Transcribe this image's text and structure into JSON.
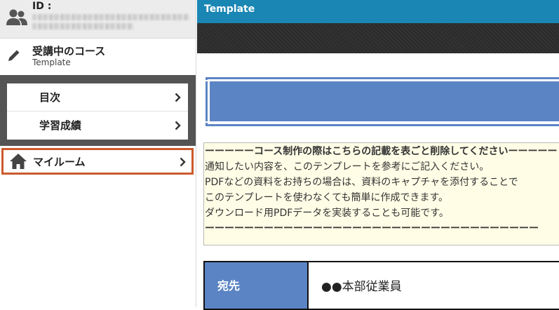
{
  "sidebar": {
    "user": {
      "id_label": "ID :"
    },
    "course": {
      "heading": "受講中のコース",
      "name": "Template"
    },
    "menu": [
      {
        "label": "目次"
      },
      {
        "label": "学習成績"
      }
    ],
    "myroom": {
      "label": "マイルーム"
    }
  },
  "main": {
    "topbar_title": "Template",
    "notice": {
      "line1": "ーーーーーコース制作の際はこちらの記載を表ごと削除してくださいーーーーー",
      "line2": "通知したい内容を、このテンプレートを参考にご記入ください。",
      "line3": "PDFなどの資料をお持ちの場合は、資料のキャプチャを添付することで",
      "line4": "このテンプレートを使わなくても簡単に作成できます。",
      "line5": "ダウンロード用PDFデータを実装することも可能です。",
      "line6": "ーーーーーーーーーーーーーーーーーーーーーーーーーーーーーーーーーー"
    },
    "table": {
      "label": "宛先",
      "value": "●●本部従業員"
    }
  },
  "colors": {
    "topbar": "#1a86b3",
    "banner": "#5b84c4",
    "highlight_border": "#cc5a2b",
    "notice_bg": "#fffde6"
  },
  "icons": [
    "users-icon",
    "pencil-icon",
    "chevron-right-icon",
    "home-icon"
  ]
}
